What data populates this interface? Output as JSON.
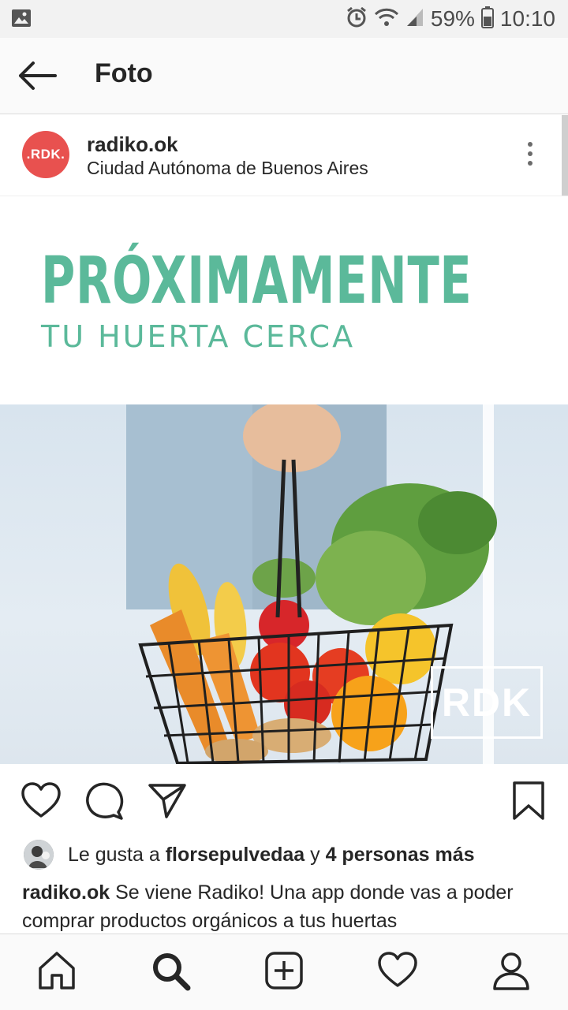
{
  "status_bar": {
    "battery": "59%",
    "time": "10:10",
    "icons": [
      "image-icon",
      "alarm-icon",
      "wifi-icon",
      "signal-icon",
      "battery-icon"
    ]
  },
  "header": {
    "title": "Foto",
    "back_icon": "arrow-left-icon"
  },
  "post": {
    "avatar_text": ".RDK.",
    "username": "radiko.ok",
    "location": "Ciudad Autónoma de Buenos Aires",
    "image": {
      "headline": "PRÓXIMAMENTE",
      "subheadline": "TU HUERTA CERCA",
      "watermark": "RDK"
    },
    "actions": [
      "heart-icon",
      "comment-icon",
      "share-icon",
      "bookmark-icon"
    ],
    "likes": {
      "prefix": "Le gusta a",
      "user": "florsepulvedaa",
      "joiner": "y",
      "others": "4 personas más"
    },
    "caption": {
      "username": "radiko.ok",
      "text": "Se viene Radiko! Una app donde vas a poder comprar productos orgánicos a tus huertas"
    }
  },
  "bottom_nav": [
    "home-icon",
    "search-icon",
    "add-icon",
    "activity-icon",
    "profile-icon"
  ],
  "colors": {
    "accent_green": "#5bb99a",
    "brand_red": "#e8514f"
  }
}
